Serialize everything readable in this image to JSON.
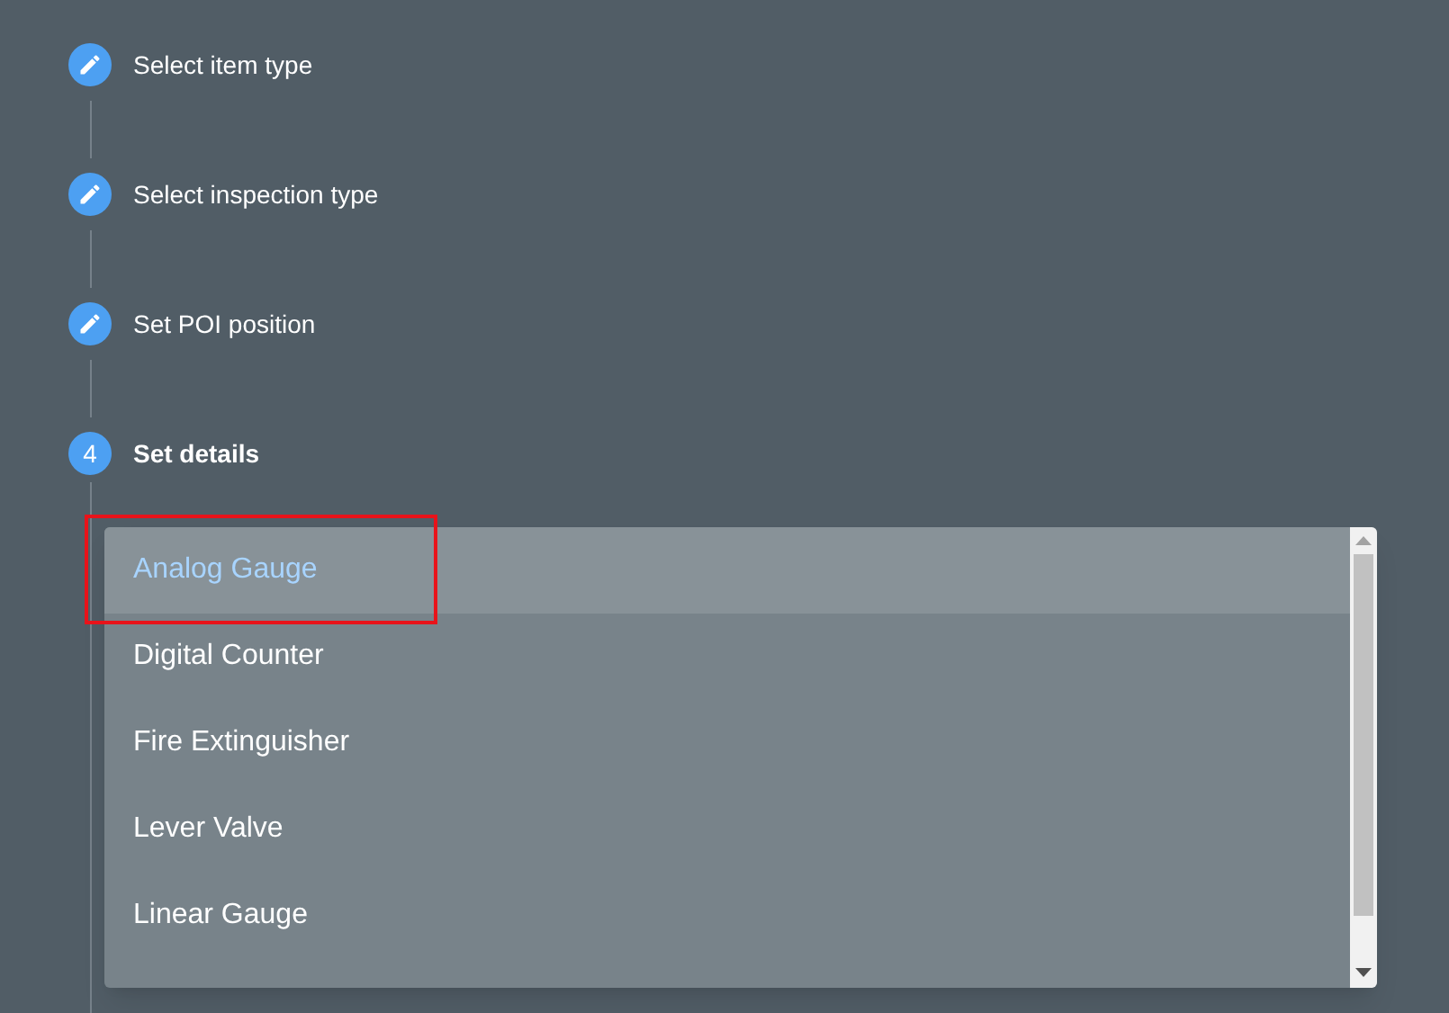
{
  "steps": [
    {
      "label": "Select item type",
      "kind": "edit",
      "active": false
    },
    {
      "label": "Select inspection type",
      "kind": "edit",
      "active": false
    },
    {
      "label": "Set POI position",
      "kind": "edit",
      "active": false
    },
    {
      "label": "Set details",
      "kind": "number",
      "number": "4",
      "active": true
    }
  ],
  "dropdown": {
    "options": [
      {
        "label": "Analog Gauge",
        "selected": true,
        "highlighted": true
      },
      {
        "label": "Digital Counter",
        "selected": false,
        "highlighted": false
      },
      {
        "label": "Fire Extinguisher",
        "selected": false,
        "highlighted": false
      },
      {
        "label": "Lever Valve",
        "selected": false,
        "highlighted": false
      },
      {
        "label": "Linear Gauge",
        "selected": false,
        "highlighted": false
      }
    ]
  }
}
